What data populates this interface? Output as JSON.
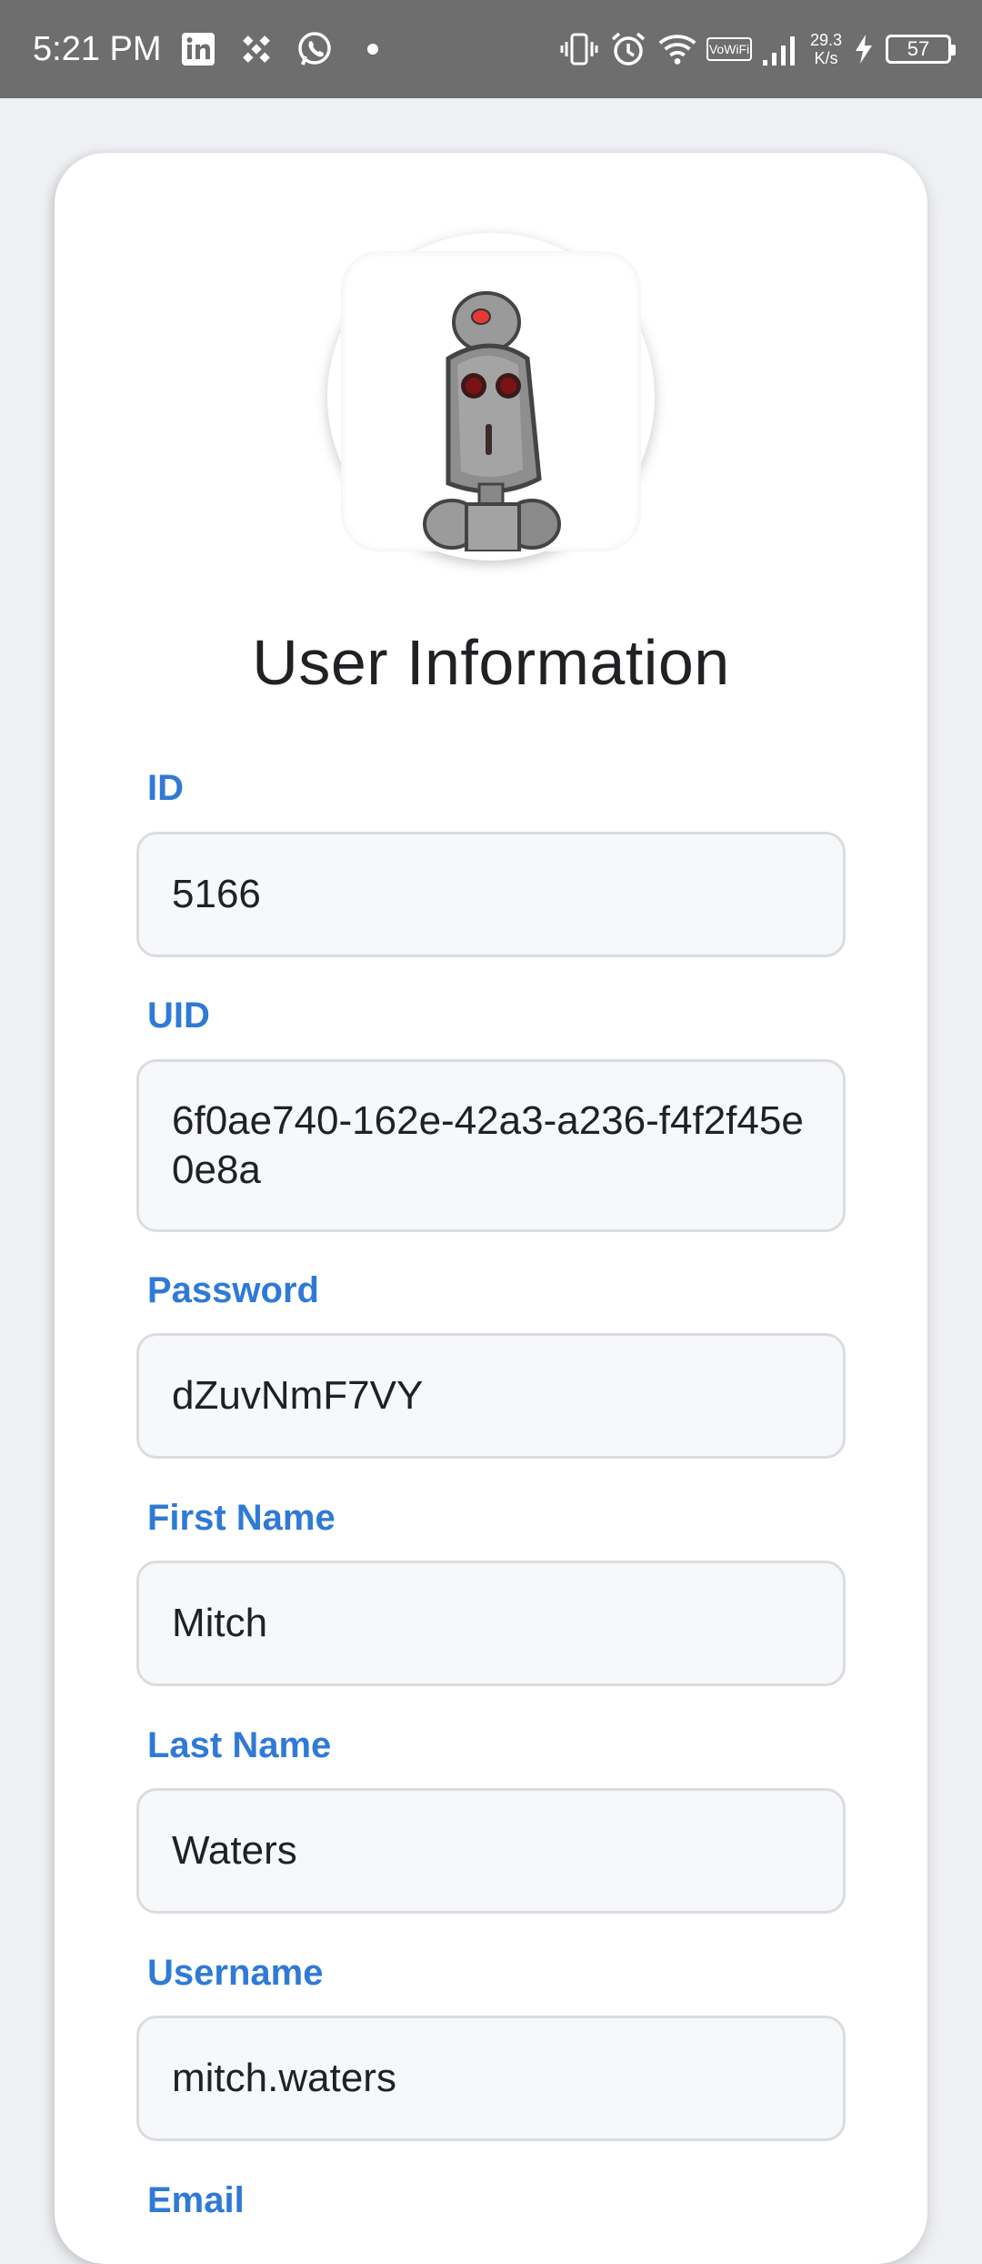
{
  "status_bar": {
    "time": "5:21 PM",
    "left_icons": [
      "linkedin-icon",
      "binance-icon",
      "whatsapp-icon",
      "dot-icon"
    ],
    "right_icons": [
      "vibrate-icon",
      "alarm-icon",
      "wifi-icon",
      "vowifi-icon",
      "signal-icon"
    ],
    "net_speed_value": "29.3",
    "net_speed_unit": "K/s",
    "battery": "57"
  },
  "page": {
    "title": "User Information",
    "avatar_icon": "robot-avatar-icon",
    "accent_color": "#2f7ad6"
  },
  "fields": {
    "id": {
      "label": "ID",
      "value": "5166"
    },
    "uid": {
      "label": "UID",
      "value": "6f0ae740-162e-42a3-a236-f4f2f45e0e8a"
    },
    "password": {
      "label": "Password",
      "value": "dZuvNmF7VY"
    },
    "first_name": {
      "label": "First Name",
      "value": "Mitch"
    },
    "last_name": {
      "label": "Last Name",
      "value": "Waters"
    },
    "username": {
      "label": "Username",
      "value": "mitch.waters"
    },
    "email": {
      "label": "Email"
    }
  }
}
